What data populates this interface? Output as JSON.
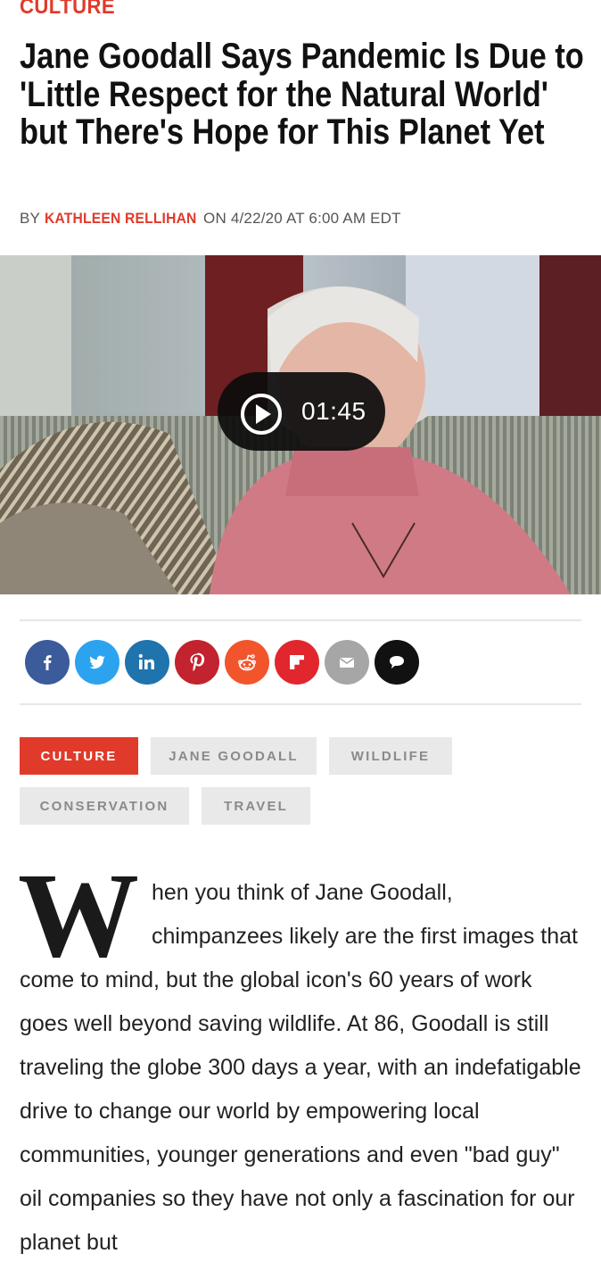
{
  "section": {
    "label": "CULTURE"
  },
  "article": {
    "headline": "Jane Goodall Says Pandemic Is Due to 'Little Respect for the Natural World' but There's Hope for This Planet Yet",
    "byline_prefix": "BY",
    "author": "KATHLEEN RELLIHAN",
    "byline_suffix": "ON 4/22/20 AT 6:00 AM EDT"
  },
  "video": {
    "duration": "01:45",
    "play_icon": "play-circle-icon"
  },
  "share": [
    {
      "name": "facebook",
      "glyph": "f",
      "color": "#3b5b9a"
    },
    {
      "name": "twitter",
      "glyph": "t",
      "color": "#2ba3ef"
    },
    {
      "name": "linkedin",
      "glyph": "in",
      "color": "#1f74ad"
    },
    {
      "name": "pinterest",
      "glyph": "P",
      "color": "#c3232e"
    },
    {
      "name": "reddit",
      "glyph": "r",
      "color": "#f2552c"
    },
    {
      "name": "flipboard",
      "glyph": "F",
      "color": "#e1262e"
    },
    {
      "name": "email",
      "glyph": "@",
      "color": "#a6a6a6"
    },
    {
      "name": "comments",
      "glyph": "c",
      "color": "#111111"
    }
  ],
  "tags": [
    "CULTURE",
    "JANE GOODALL",
    "WILDLIFE",
    "CONSERVATION",
    "TRAVEL"
  ],
  "body": {
    "dropcap": "W",
    "paragraph": "hen you think of Jane Goodall, chimpanzees likely are the first images that come to mind, but the global icon's 60 years of work goes well beyond saving wildlife. At 86, Goodall is still traveling the globe 300 days a year, with an indefatigable drive to change our world by empowering local communities, younger generations and even \"bad guy\" oil companies so they have not only a fascination for our planet but"
  },
  "colors": {
    "accent": "#e03a2b",
    "tag_bg": "#e9e9e9",
    "tag_text": "#8a8a8a"
  }
}
